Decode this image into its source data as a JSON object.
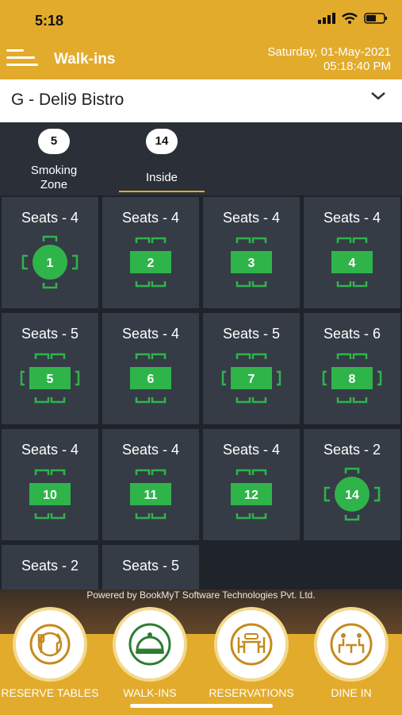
{
  "status": {
    "time": "5:18"
  },
  "header": {
    "title": "Walk-ins",
    "date": "Saturday, 01-May-2021",
    "time": "05:18:40 PM"
  },
  "venue": {
    "name": "G - Deli9 Bistro"
  },
  "tabs": [
    {
      "label": "Smoking\nZone",
      "count": "5"
    },
    {
      "label": "Inside",
      "count": "14",
      "active": true
    }
  ],
  "tables": [
    {
      "seats": "Seats - 4",
      "number": "1",
      "shape": "round"
    },
    {
      "seats": "Seats - 4",
      "number": "2",
      "shape": "rect"
    },
    {
      "seats": "Seats - 4",
      "number": "3",
      "shape": "rect"
    },
    {
      "seats": "Seats - 4",
      "number": "4",
      "shape": "rect"
    },
    {
      "seats": "Seats - 5",
      "number": "5",
      "shape": "rect"
    },
    {
      "seats": "Seats - 4",
      "number": "6",
      "shape": "rect"
    },
    {
      "seats": "Seats - 5",
      "number": "7",
      "shape": "rect"
    },
    {
      "seats": "Seats - 6",
      "number": "8",
      "shape": "rect"
    },
    {
      "seats": "Seats - 4",
      "number": "10",
      "shape": "rect"
    },
    {
      "seats": "Seats - 4",
      "number": "11",
      "shape": "rect"
    },
    {
      "seats": "Seats - 4",
      "number": "12",
      "shape": "rect"
    },
    {
      "seats": "Seats - 2",
      "number": "14",
      "shape": "round"
    },
    {
      "seats": "Seats - 2",
      "number": "",
      "shape": "none"
    },
    {
      "seats": "Seats - 5",
      "number": "",
      "shape": "none"
    }
  ],
  "footer": {
    "powered": "Powered by BookMyT Software Technologies Pvt. Ltd.",
    "nav": [
      {
        "label": "RESERVE TABLES",
        "icon": "reserve-tables-icon"
      },
      {
        "label": "WALK-INS",
        "icon": "walk-ins-icon",
        "active": true
      },
      {
        "label": "RESERVATIONS",
        "icon": "reservations-icon"
      },
      {
        "label": "DINE IN",
        "icon": "dine-in-icon"
      }
    ]
  },
  "colors": {
    "accent": "#e2ab2b",
    "table_green": "#2fb44a",
    "cell_bg": "#353c46"
  }
}
